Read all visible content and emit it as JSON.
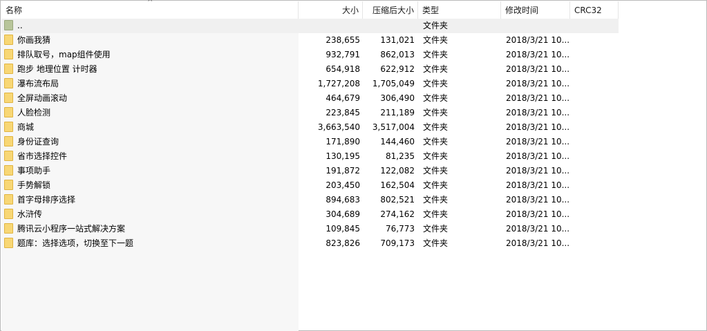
{
  "columns": {
    "name": "名称",
    "size": "大小",
    "packed": "压缩后大小",
    "type": "类型",
    "modified": "修改时间",
    "crc": "CRC32",
    "sort_indicator": "^"
  },
  "parent_row": {
    "name": "..",
    "type": "文件夹",
    "icon": "folder-up-icon"
  },
  "rows": [
    {
      "name": "你画我猜",
      "size": "238,655",
      "packed": "131,021",
      "type": "文件夹",
      "modified": "2018/3/21 10...",
      "crc": ""
    },
    {
      "name": "排队取号，map组件使用",
      "size": "932,791",
      "packed": "862,013",
      "type": "文件夹",
      "modified": "2018/3/21 10...",
      "crc": ""
    },
    {
      "name": "跑步 地理位置 计时器",
      "size": "654,918",
      "packed": "622,912",
      "type": "文件夹",
      "modified": "2018/3/21 10...",
      "crc": ""
    },
    {
      "name": "瀑布流布局",
      "size": "1,727,208",
      "packed": "1,705,049",
      "type": "文件夹",
      "modified": "2018/3/21 10...",
      "crc": ""
    },
    {
      "name": "全屏动画滚动",
      "size": "464,679",
      "packed": "306,490",
      "type": "文件夹",
      "modified": "2018/3/21 10...",
      "crc": ""
    },
    {
      "name": "人脸检测",
      "size": "223,845",
      "packed": "211,189",
      "type": "文件夹",
      "modified": "2018/3/21 10...",
      "crc": ""
    },
    {
      "name": "商城",
      "size": "3,663,540",
      "packed": "3,517,004",
      "type": "文件夹",
      "modified": "2018/3/21 10...",
      "crc": ""
    },
    {
      "name": "身份证查询",
      "size": "171,890",
      "packed": "144,460",
      "type": "文件夹",
      "modified": "2018/3/21 10...",
      "crc": ""
    },
    {
      "name": "省市选择控件",
      "size": "130,195",
      "packed": "81,235",
      "type": "文件夹",
      "modified": "2018/3/21 10...",
      "crc": ""
    },
    {
      "name": "事项助手",
      "size": "191,872",
      "packed": "122,082",
      "type": "文件夹",
      "modified": "2018/3/21 10...",
      "crc": ""
    },
    {
      "name": "手势解锁",
      "size": "203,450",
      "packed": "162,504",
      "type": "文件夹",
      "modified": "2018/3/21 10...",
      "crc": ""
    },
    {
      "name": "首字母排序选择",
      "size": "894,683",
      "packed": "802,521",
      "type": "文件夹",
      "modified": "2018/3/21 10...",
      "crc": ""
    },
    {
      "name": "水浒传",
      "size": "304,689",
      "packed": "274,162",
      "type": "文件夹",
      "modified": "2018/3/21 10...",
      "crc": ""
    },
    {
      "name": "腾讯云小程序一站式解决方案",
      "size": "109,845",
      "packed": "76,773",
      "type": "文件夹",
      "modified": "2018/3/21 10...",
      "crc": ""
    },
    {
      "name": "题库：选择选项，切换至下一题",
      "size": "823,826",
      "packed": "709,173",
      "type": "文件夹",
      "modified": "2018/3/21 10...",
      "crc": ""
    }
  ],
  "colors": {
    "folder": "#f8d775",
    "folder_up": "#b8c59a",
    "name_column_bg": "#f7f7f7"
  }
}
